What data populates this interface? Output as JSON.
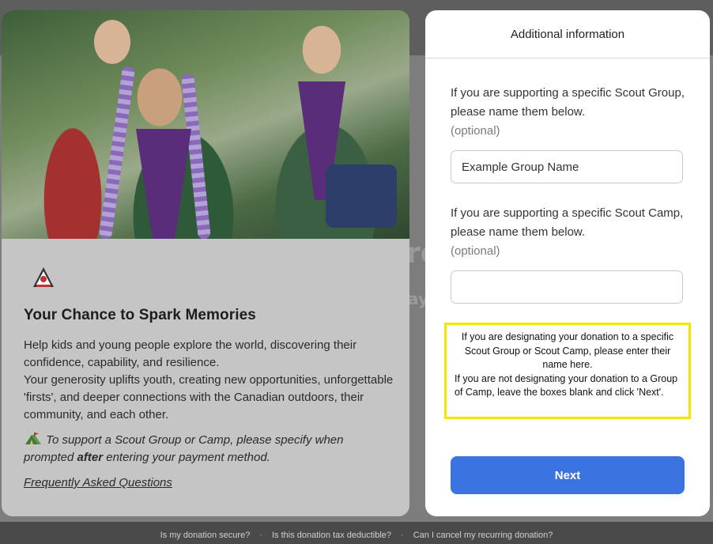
{
  "background": {
    "fragment_1": "re",
    "fragment_2": "ay,"
  },
  "left_card": {
    "logo_icon": "scouts-canada-logo",
    "title": "Your Chance to Spark Memories",
    "description_1": "Help kids and young people explore the world, discovering their confidence, capability, and resilience.",
    "description_2": "Your generosity uplifts youth, creating new opportunities, unforgettable 'firsts', and deeper connections with the Canadian outdoors, their community, and each other.",
    "tip_icon": "tent-icon",
    "tip_before": "To support a Scout Group or Camp, please specify when prompted ",
    "tip_bold": "after",
    "tip_after": " entering your payment method.",
    "faq_link": "Frequently Asked Questions"
  },
  "modal": {
    "title": "Additional information",
    "group_label": "If you are supporting a specific Scout Group, please name them below.",
    "group_optional": "(optional)",
    "group_placeholder": "Example Group Name",
    "camp_label": "If you are supporting a specific Scout Camp, please name them below.",
    "camp_optional": "(optional)",
    "camp_placeholder": "",
    "notice_line_1": "If you are designating your donation to a specific Scout Group or Scout Camp, please enter their name here.",
    "notice_line_2": "If you are not designating your donation to a Group of Camp, leave the boxes blank and click 'Next'.",
    "next_label": "Next"
  },
  "footer": {
    "link_1": "Is my donation secure?",
    "link_2": "Is this donation tax deductible?",
    "link_3": "Can I cancel my recurring donation?",
    "separator": "·"
  },
  "colors": {
    "accent": "#3b74e0",
    "highlight": "#f2e600"
  }
}
